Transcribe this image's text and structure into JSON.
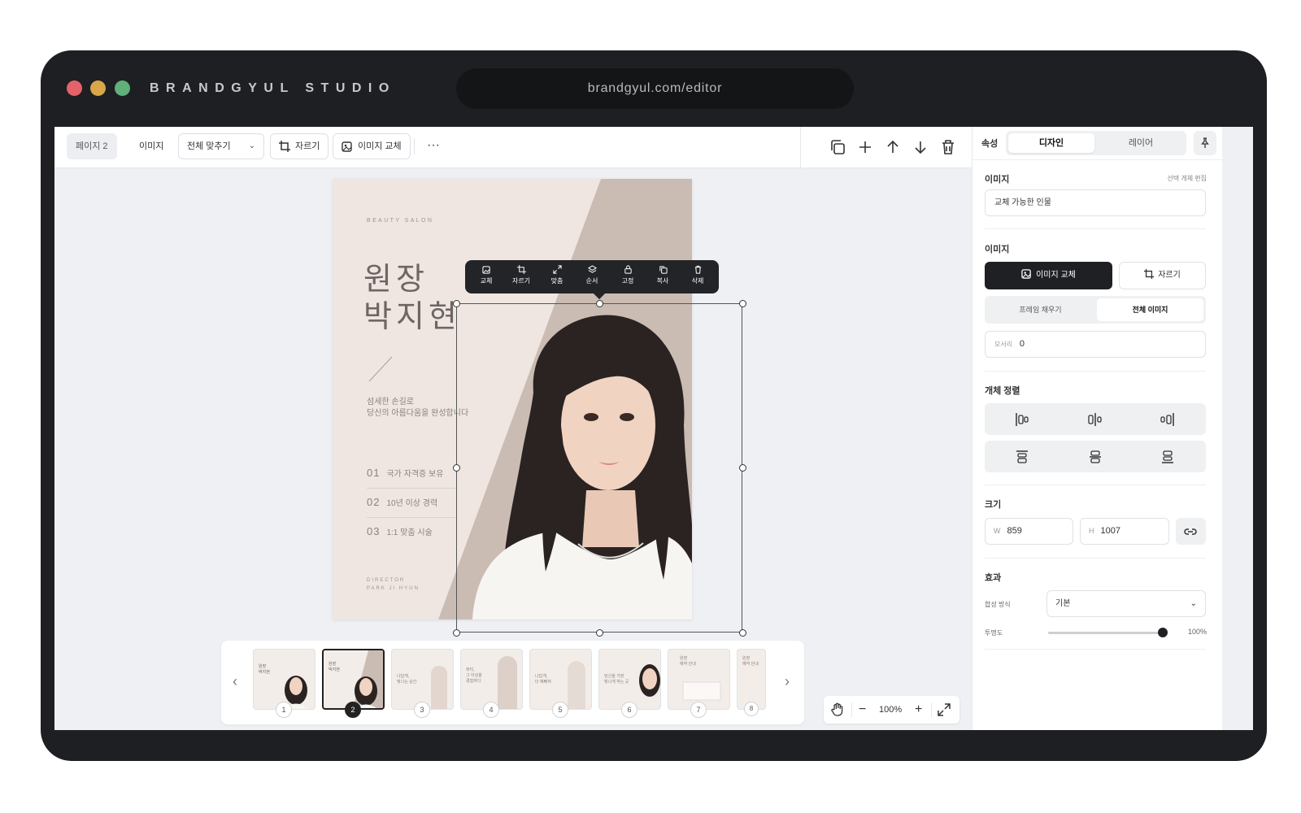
{
  "window": {
    "brand": "BRANDGYUL STUDIO",
    "url": "brandgyul.com/editor"
  },
  "toolbar": {
    "page_badge": "페이지 2",
    "type_label": "이미지",
    "fit_select": "전체 맞추기",
    "crop_label": "자르기",
    "replace_label": "이미지 교체",
    "more_label": "···"
  },
  "poster": {
    "subtitle": "BEAUTY SALON",
    "title_line1": "원장",
    "title_line2": "박지현",
    "desc_line1": "섬세한 손길로",
    "desc_line2": "당신의 아름다움을 완성합니다",
    "features": [
      {
        "num": "01",
        "text": "국가 자격증 보유"
      },
      {
        "num": "02",
        "text": "10년 이상 경력"
      },
      {
        "num": "03",
        "text": "1:1 맞춤 시술"
      }
    ],
    "director_line1": "DIRECTOR",
    "director_line2": "PARK JI HYUN"
  },
  "context_menu": [
    {
      "label": "교체",
      "icon": "replace-image-icon"
    },
    {
      "label": "자르기",
      "icon": "crop-icon"
    },
    {
      "label": "맞춤",
      "icon": "expand-icon"
    },
    {
      "label": "순서",
      "icon": "layers-icon"
    },
    {
      "label": "고정",
      "icon": "lock-icon"
    },
    {
      "label": "복사",
      "icon": "copy-icon"
    },
    {
      "label": "삭제",
      "icon": "trash-icon"
    }
  ],
  "filmstrip": {
    "pages": [
      "1",
      "2",
      "3",
      "4",
      "5",
      "6",
      "7",
      "8"
    ],
    "active": "2",
    "thumb_texts": {
      "t1": "원장\n박지현",
      "t2": "원장\n박지현",
      "t3": "나답게,\n빛나는 순간",
      "t4": "뷰티,\n그 이상을\n경험하다",
      "t5": "나답게,\n더 예뻐져",
      "t6": "당신을 가장\n빛나게 하는 곳",
      "t7": "원장\n예약 안내",
      "t8": "원장\n예약 안내"
    }
  },
  "zoom": {
    "value": "100%"
  },
  "panel": {
    "header_label": "속성",
    "tabs": [
      "디자인",
      "레이어"
    ],
    "active_tab": "디자인",
    "image_section": "이미지",
    "edit_hint": "선택 개체 편집",
    "image_name": "교체 가능한 인물",
    "image_section2": "이미지",
    "replace_button": "이미지 교체",
    "crop_button": "자르기",
    "fill_options": [
      "프레임 채우기",
      "전체 이미지"
    ],
    "fill_active": "전체 이미지",
    "corner_label": "모서리",
    "corner_value": "0",
    "align_title": "개체 정렬",
    "size_title": "크기",
    "width_label": "W",
    "width_value": "859",
    "height_label": "H",
    "height_value": "1007",
    "effects_title": "효과",
    "blend_label": "합성 방식",
    "blend_value": "기본",
    "opacity_label": "투명도",
    "opacity_value": "100%",
    "opacity_fraction": 1.0
  },
  "colors": {
    "frame": "#1e1f22",
    "canvas": "#eef0f3",
    "poster": "#efe6e2",
    "accent_dark": "#1f2023"
  }
}
